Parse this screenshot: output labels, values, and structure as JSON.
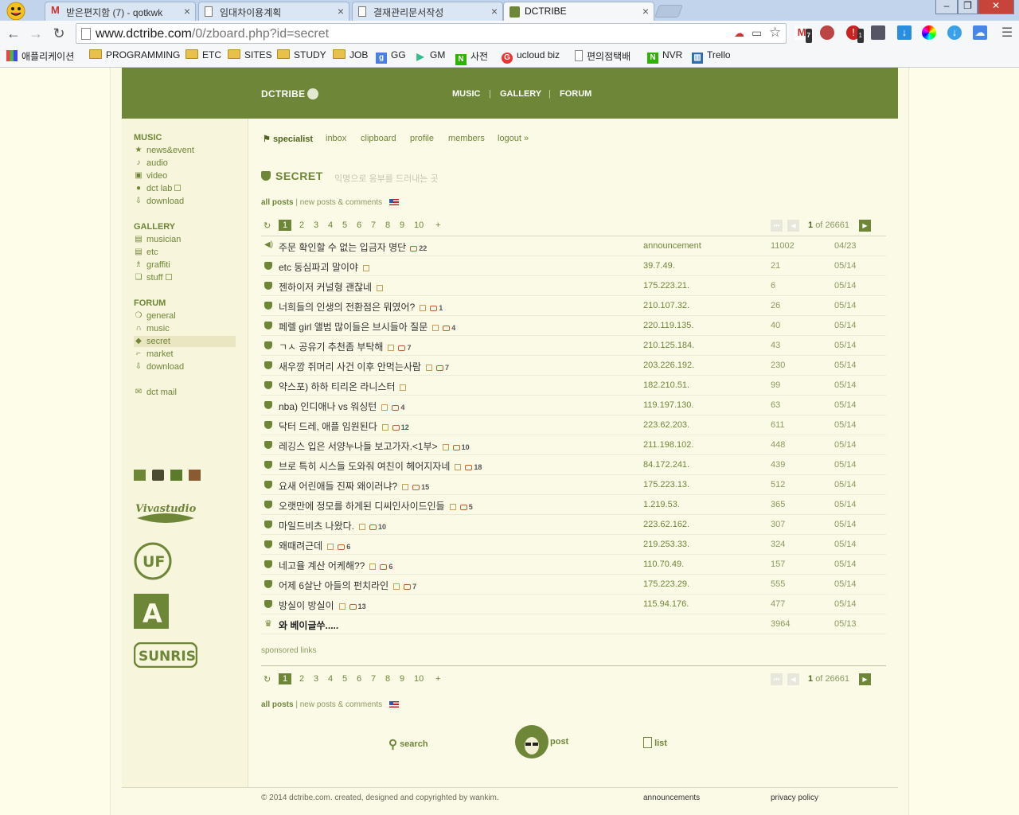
{
  "browser": {
    "tabs": [
      {
        "title": "받은편지함 (7) - qotkwk",
        "icon": "gmail-icon"
      },
      {
        "title": "임대차이용계획",
        "icon": "document-icon"
      },
      {
        "title": "결재관리문서작성",
        "icon": "document-icon"
      },
      {
        "title": "DCTRIBE",
        "icon": "dctribe-icon",
        "active": true
      }
    ],
    "url_host": "www.dctribe.com",
    "url_path": "/0/zboard.php?id=secret",
    "window_controls": [
      "–",
      "❐",
      "✕"
    ],
    "extensions": {
      "gmail_count": "7",
      "ext2_count": "1"
    },
    "bookmarks": [
      {
        "label": "애플리케이션",
        "icon": "apps-grid-icon"
      },
      {
        "label": "PROGRAMMING",
        "icon": "folder-icon"
      },
      {
        "label": "ETC",
        "icon": "folder-icon"
      },
      {
        "label": "SITES",
        "icon": "folder-icon"
      },
      {
        "label": "STUDY",
        "icon": "folder-icon"
      },
      {
        "label": "JOB",
        "icon": "folder-icon"
      },
      {
        "label": "GG",
        "icon": "google-icon"
      },
      {
        "label": "GM",
        "icon": "play-icon"
      },
      {
        "label": "사전",
        "icon": "naver-icon"
      },
      {
        "label": "ucloud biz",
        "icon": "ucloud-icon"
      },
      {
        "label": "편의점택배",
        "icon": "page-icon"
      },
      {
        "label": "NVR",
        "icon": "naver-icon"
      },
      {
        "label": "Trello",
        "icon": "trello-icon"
      }
    ]
  },
  "site": {
    "logo": "DCTRIBE",
    "nav": [
      "MUSIC",
      "GALLERY",
      "FORUM"
    ],
    "nav_sep": "|"
  },
  "sidebar": {
    "music": {
      "heading": "MUSIC",
      "items": [
        {
          "label": "news&event",
          "icon": "star-icon"
        },
        {
          "label": "audio",
          "icon": "note-icon"
        },
        {
          "label": "video",
          "icon": "video-icon"
        },
        {
          "label": "dct lab",
          "icon": "lab-icon",
          "new": true
        },
        {
          "label": "download",
          "icon": "download-icon"
        }
      ]
    },
    "gallery": {
      "heading": "GALLERY",
      "items": [
        {
          "label": "musician",
          "icon": "camera-icon"
        },
        {
          "label": "etc",
          "icon": "camera-icon"
        },
        {
          "label": "graffiti",
          "icon": "spray-icon"
        },
        {
          "label": "stuff",
          "icon": "stuff-icon",
          "new": true
        }
      ]
    },
    "forum": {
      "heading": "FORUM",
      "items": [
        {
          "label": "general",
          "icon": "speech-icon"
        },
        {
          "label": "music",
          "icon": "headphones-icon"
        },
        {
          "label": "secret",
          "icon": "shield-icon",
          "active": true
        },
        {
          "label": "market",
          "icon": "cart-icon"
        },
        {
          "label": "download",
          "icon": "download-icon"
        }
      ]
    },
    "mail": {
      "label": "dct mail",
      "icon": "mail-icon"
    },
    "logos": [
      "Vivastudio",
      "UF",
      "A",
      "SUNRISE"
    ]
  },
  "subnav": [
    "specialist",
    "inbox",
    "clipboard",
    "profile",
    "members",
    "logout »"
  ],
  "board": {
    "title": "SECRET",
    "subtitle": "익명으로 응부를 드러내는 곳",
    "filter_all": "all posts",
    "filter_sep": "|",
    "filter_new": "new posts & comments"
  },
  "pagination": {
    "current": "1",
    "pages": [
      "2",
      "3",
      "4",
      "5",
      "6",
      "7",
      "8",
      "9",
      "10"
    ],
    "more": "+",
    "page_now": "1",
    "of_label": "of",
    "total_pages": "26661"
  },
  "posts": [
    {
      "title": "주문 확인할 수 없는 입금자 명단",
      "comments": "22",
      "ip": "announcement",
      "hits": "11002",
      "date": "04/23",
      "icon": "speaker-icon"
    },
    {
      "title": "etc 동심파괴 말이야",
      "comments": "",
      "ip": "39.7.49.",
      "hits": "21",
      "date": "05/14",
      "new": true
    },
    {
      "title": "젠하이저 커널형 괜찮네",
      "comments": "",
      "ip": "175.223.21.",
      "hits": "6",
      "date": "05/14",
      "new": true
    },
    {
      "title": "너희들의 인생의 전환점은 뭐였어?",
      "comments": "1",
      "ip": "210.107.32.",
      "hits": "26",
      "date": "05/14",
      "new": true
    },
    {
      "title": "페렐 girl 앨범 많이들은 브시들아 질문",
      "comments": "4",
      "ip": "220.119.135.",
      "hits": "40",
      "date": "05/14",
      "new": true
    },
    {
      "title": "ㄱㅅ 공유기 추천좀 부탁해",
      "comments": "7",
      "ip": "210.125.184.",
      "hits": "43",
      "date": "05/14",
      "new": true
    },
    {
      "title": "새우깡 쥐머리 사건 이후 안먹는사람",
      "comments": "7",
      "ip": "203.226.192.",
      "hits": "230",
      "date": "05/14",
      "new": true
    },
    {
      "title": "약스포) 하하 티리온 라니스터",
      "comments": "",
      "ip": "182.210.51.",
      "hits": "99",
      "date": "05/14",
      "new": true
    },
    {
      "title": "nba) 인디애나 vs 워싱턴",
      "comments": "4",
      "ip": "119.197.130.",
      "hits": "63",
      "date": "05/14",
      "new": true
    },
    {
      "title": "닥터 드레, 애플 임원된다",
      "comments": "12",
      "ip": "223.62.203.",
      "hits": "611",
      "date": "05/14",
      "new": true
    },
    {
      "title": "레깅스 입은 서양누나들 보고가자.<1부>",
      "comments": "10",
      "ip": "211.198.102.",
      "hits": "448",
      "date": "05/14",
      "new": true
    },
    {
      "title": "브로 특히 시스들 도와줘 여친이 헤어지자네",
      "comments": "18",
      "ip": "84.172.241.",
      "hits": "439",
      "date": "05/14",
      "new": true
    },
    {
      "title": "요새 어린애들 진짜 왜이러냐?",
      "comments": "15",
      "ip": "175.223.13.",
      "hits": "512",
      "date": "05/14",
      "new": true
    },
    {
      "title": "오랫만에 정모를 하게된 디씨인사이드인들",
      "comments": "5",
      "ip": "1.219.53.",
      "hits": "365",
      "date": "05/14",
      "new": true
    },
    {
      "title": "마일드비츠 나왔다.",
      "comments": "10",
      "ip": "223.62.162.",
      "hits": "307",
      "date": "05/14",
      "new": true
    },
    {
      "title": "왜때려근데",
      "comments": "6",
      "ip": "219.253.33.",
      "hits": "324",
      "date": "05/14",
      "new": true
    },
    {
      "title": "네고율 계산 어케해??",
      "comments": "6",
      "ip": "110.70.49.",
      "hits": "157",
      "date": "05/14",
      "new": true
    },
    {
      "title": "어제 6살난 아들의 펀치라인",
      "comments": "7",
      "ip": "175.223.29.",
      "hits": "555",
      "date": "05/14",
      "new": true
    },
    {
      "title": "방실이 방실이",
      "comments": "13",
      "ip": "115.94.176.",
      "hits": "477",
      "date": "05/14",
      "new": true
    },
    {
      "title": "와 베이글쑤.....",
      "comments": "",
      "ip": "",
      "hits": "3964",
      "date": "05/13",
      "icon": "crown-icon",
      "bold": true
    }
  ],
  "sponsored": "sponsored links",
  "actions": {
    "search": "search",
    "post": "post",
    "list": "list"
  },
  "footer": {
    "copyright": "© 2014 dctribe.com. created, designed and copyrighted by wankim.",
    "announcements": "announcements",
    "privacy": "privacy policy"
  },
  "colors": {
    "brand": "#6e8638",
    "background": "#fdfde9",
    "sidebar": "#f7f5db"
  }
}
